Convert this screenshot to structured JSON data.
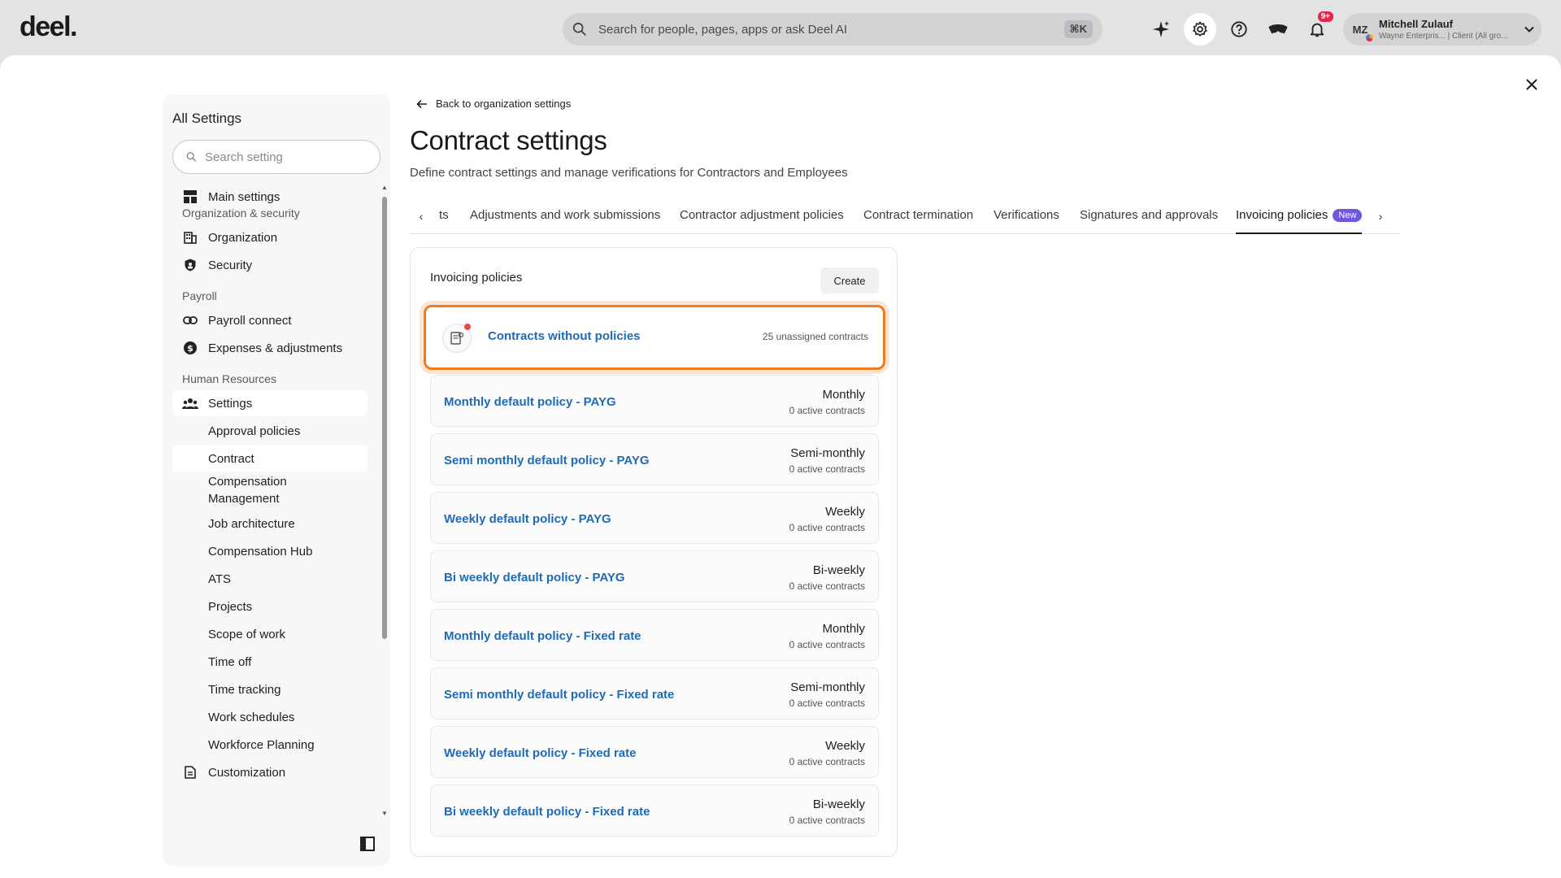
{
  "topbar": {
    "logo": "deel.",
    "search_placeholder": "Search for people, pages, apps or ask Deel AI",
    "search_shortcut": "⌘K",
    "notifications_badge": "9+",
    "user": {
      "initials": "MZ",
      "name": "Mitchell Zulauf",
      "subtitle": "Wayne Enterpris... | Client (All gro..."
    }
  },
  "sidebar": {
    "title": "All Settings",
    "search_placeholder": "Search setting",
    "main_settings": "Main settings",
    "sections": {
      "org_security": "Organization & security",
      "payroll": "Payroll",
      "hr": "Human Resources"
    },
    "items": {
      "organization": "Organization",
      "security": "Security",
      "payroll_connect": "Payroll connect",
      "expenses": "Expenses & adjustments",
      "settings": "Settings",
      "approval_policies": "Approval policies",
      "contract": "Contract",
      "compensation_management_1": "Compensation",
      "compensation_management_2": "Management",
      "job_architecture": "Job architecture",
      "compensation_hub": "Compensation Hub",
      "ats": "ATS",
      "projects": "Projects",
      "scope_of_work": "Scope of work",
      "time_off": "Time off",
      "time_tracking": "Time tracking",
      "work_schedules": "Work schedules",
      "workforce_planning": "Workforce Planning",
      "customization": "Customization"
    }
  },
  "content": {
    "back_link": "Back to organization settings",
    "title": "Contract settings",
    "description": "Define contract settings and manage verifications for Contractors and Employees",
    "tabs": {
      "partial": "ts",
      "adjustments": "Adjustments and work submissions",
      "contractor_adjustment": "Contractor adjustment policies",
      "termination": "Contract termination",
      "verifications": "Verifications",
      "signatures": "Signatures and approvals",
      "invoicing": "Invoicing policies",
      "new_badge": "New"
    },
    "card": {
      "title": "Invoicing policies",
      "create_label": "Create",
      "unassigned": {
        "label": "Contracts without policies",
        "count": "25 unassigned contracts"
      },
      "policies": [
        {
          "name": "Monthly default policy - PAYG",
          "frequency": "Monthly",
          "count": "0 active contracts"
        },
        {
          "name": "Semi monthly default policy - PAYG",
          "frequency": "Semi-monthly",
          "count": "0 active contracts"
        },
        {
          "name": "Weekly default policy - PAYG",
          "frequency": "Weekly",
          "count": "0 active contracts"
        },
        {
          "name": "Bi weekly default policy - PAYG",
          "frequency": "Bi-weekly",
          "count": "0 active contracts"
        },
        {
          "name": "Monthly default policy - Fixed rate",
          "frequency": "Monthly",
          "count": "0 active contracts"
        },
        {
          "name": "Semi monthly default policy - Fixed rate",
          "frequency": "Semi-monthly",
          "count": "0 active contracts"
        },
        {
          "name": "Weekly default policy - Fixed rate",
          "frequency": "Weekly",
          "count": "0 active contracts"
        },
        {
          "name": "Bi weekly default policy - Fixed rate",
          "frequency": "Bi-weekly",
          "count": "0 active contracts"
        }
      ]
    }
  },
  "colors": {
    "link_blue": "#1f6bb5",
    "highlight_orange": "#f07a1e",
    "new_badge_purple": "#7156e0",
    "notification_red": "#e0284a"
  }
}
